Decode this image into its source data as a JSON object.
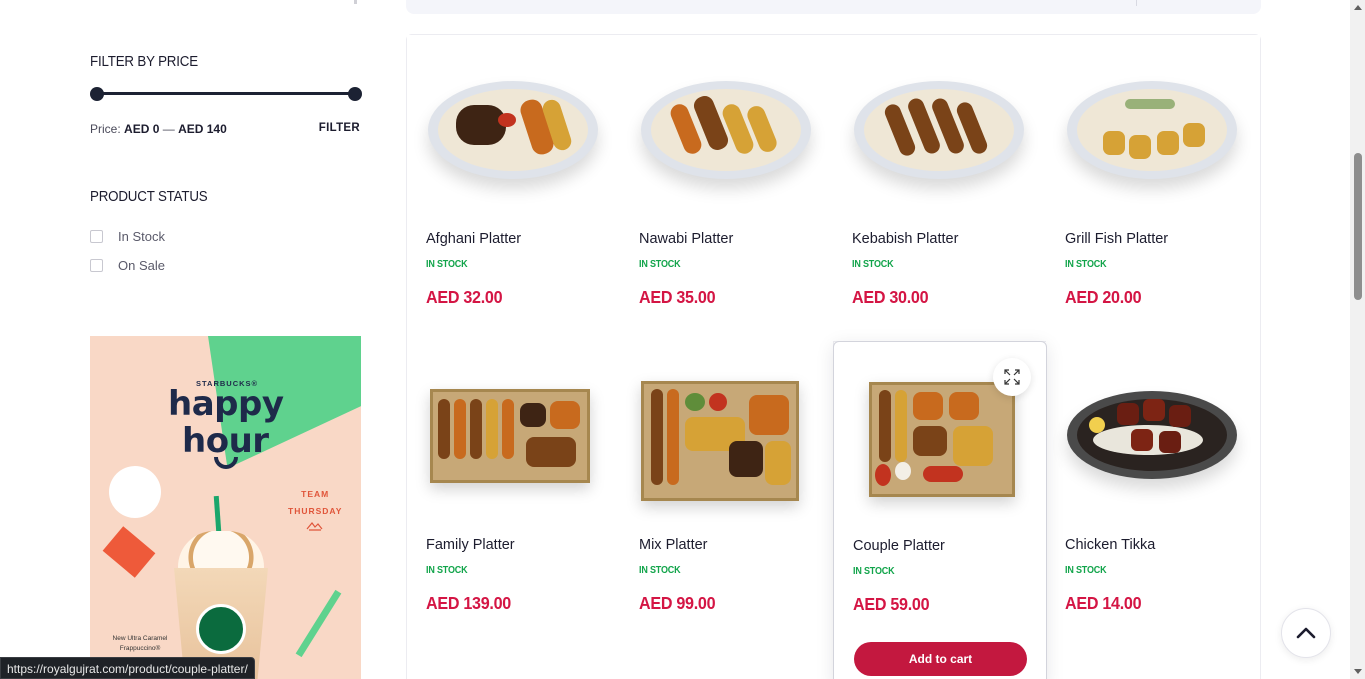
{
  "sidebar": {
    "filter_price": {
      "title": "FILTER BY PRICE",
      "price_label": "Price:",
      "min": "AED 0",
      "dash": "—",
      "max": "AED 140",
      "filter_button": "FILTER"
    },
    "product_status": {
      "title": "PRODUCT STATUS",
      "options": [
        {
          "label": "In Stock",
          "checked": false
        },
        {
          "label": "On Sale",
          "checked": false
        }
      ]
    },
    "banner": {
      "brand": "STARBUCKS®",
      "line1": "happy",
      "line2": "hour",
      "tag_line1": "TEAM",
      "tag_line2": "THURSDAY",
      "caption": "New Ultra Caramel Frappuccino®"
    }
  },
  "products": [
    {
      "name": "Afghani Platter",
      "stock": "IN STOCK",
      "price": "AED 32.00",
      "image": "plate-kebab-rice"
    },
    {
      "name": "Nawabi Platter",
      "stock": "IN STOCK",
      "price": "AED 35.00",
      "image": "plate-kebab-rice"
    },
    {
      "name": "Kebabish Platter",
      "stock": "IN STOCK",
      "price": "AED 30.00",
      "image": "plate-kebab-rice"
    },
    {
      "name": "Grill Fish Platter",
      "stock": "IN STOCK",
      "price": "AED 20.00",
      "image": "plate-fish-rice"
    },
    {
      "name": "Family Platter",
      "stock": "IN STOCK",
      "price": "AED 139.00",
      "image": "tray-mixed-grill"
    },
    {
      "name": "Mix Platter",
      "stock": "IN STOCK",
      "price": "AED 99.00",
      "image": "tray-mixed-grill"
    },
    {
      "name": "Couple Platter",
      "stock": "IN STOCK",
      "price": "AED 59.00",
      "image": "tray-mixed-grill",
      "add_to_cart": "Add to cart"
    },
    {
      "name": "Chicken Tikka",
      "stock": "IN STOCK",
      "price": "AED 14.00",
      "image": "sizzler-tikka"
    }
  ],
  "icons": {
    "expand": "expand-icon",
    "scroll_top": "chevron-up-icon"
  },
  "colors": {
    "price": "#d41544",
    "in_stock": "#11a44a",
    "add_to_cart": "#c3183f"
  },
  "status_url": "https://royalgujrat.com/product/couple-platter/"
}
